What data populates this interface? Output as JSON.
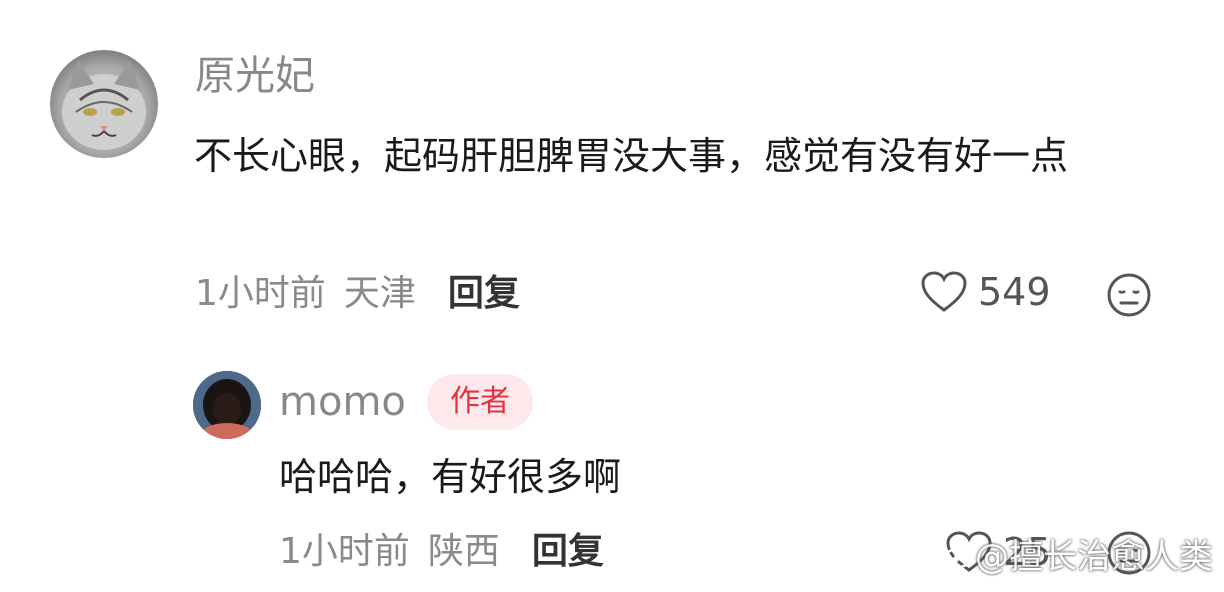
{
  "comment": {
    "username": "原光妃",
    "text": "不长心眼，起码肝胆脾胃没大事，感觉有没有好一点",
    "time": "1小时前",
    "location": "天津",
    "reply_label": "回复",
    "likes": "549",
    "avatar_icon": "cat-avatar",
    "reply": {
      "username": "momo",
      "badge": "作者",
      "text": "哈哈哈，有好很多啊",
      "time": "1小时前",
      "location": "陕西",
      "reply_label": "回复",
      "likes": "25",
      "avatar_icon": "person-avatar"
    }
  },
  "watermark": {
    "text": "@擅长治愈人类"
  },
  "colors": {
    "username": "#888888",
    "text": "#1a1a1a",
    "badge_bg": "#fde8ec",
    "badge_text": "#e0333f",
    "meta": "#8a8a8a"
  }
}
